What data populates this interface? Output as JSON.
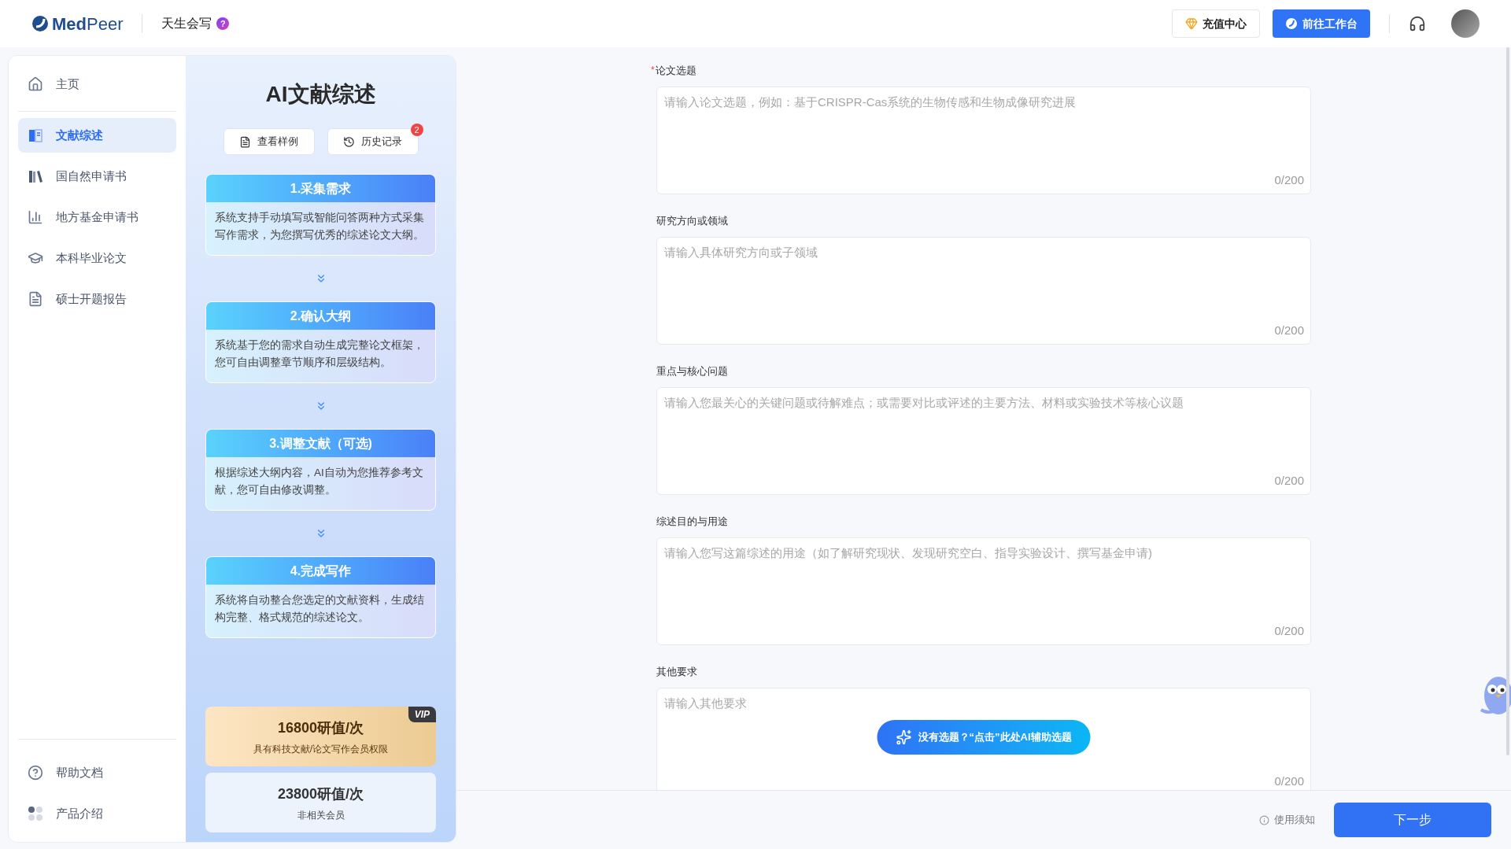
{
  "header": {
    "logo": "**Med**Peer",
    "product": "天生会写",
    "help_mark": "?",
    "buttons": [
      {
        "kind": "recharge",
        "label": "充值中心"
      },
      {
        "kind": "workbench",
        "label": "前往工作台"
      }
    ]
  },
  "sidebar": {
    "items": [
      {
        "label": "主页",
        "selected": false
      },
      {
        "label": "文献综述",
        "selected": true
      },
      {
        "label": "国自然申请书",
        "selected": false
      },
      {
        "label": "地方基金申请书",
        "selected": false
      },
      {
        "label": "本科毕业论文",
        "selected": false
      },
      {
        "label": "硕士开题报告",
        "selected": false
      }
    ],
    "bottom_items": [
      {
        "label": "帮助文档"
      },
      {
        "label": "产品介绍"
      }
    ]
  },
  "panel": {
    "title": "AI文献综述",
    "buttons": [
      {
        "kind": "sample",
        "label": "查看样例"
      },
      {
        "kind": "history",
        "label": "历史记录",
        "badge": "2"
      }
    ],
    "steps": [
      {
        "title": "1.采集需求",
        "text": "系统支持手动填写或智能问答两种方式采集写作需求，为您撰写优秀的综述论文大纲。"
      },
      {
        "title": "2.确认大纲",
        "text": "系统基于您的需求自动生成完整论文框架，您可自由调整章节顺序和层级结构。"
      },
      {
        "title": "3.调整文献（可选)",
        "text": "根据综述大纲内容，AI自动为您推荐参考文献，您可自由修改调整。"
      },
      {
        "title": "4.完成写作",
        "text": "系统将自动整合您选定的文献资料，生成结构完整、格式规范的综述论文。"
      }
    ],
    "pricing": [
      {
        "kind": "vip",
        "badge": "VIP",
        "price": "16800研值/次",
        "note": "具有科技文献/论文写作会员权限"
      },
      {
        "kind": "normal",
        "price": "23800研值/次",
        "note": "非相关会员"
      }
    ]
  },
  "form": {
    "required_mark": "*",
    "fields": [
      {
        "label": "论文选题",
        "required": true,
        "placeholder": "请输入论文选题，例如：基于CRISPR-Cas系统的生物传感和生物成像研究进展",
        "counter": "0/200"
      },
      {
        "label": "研究方向或领域",
        "required": false,
        "placeholder": "请输入具体研究方向或子领域",
        "counter": "0/200"
      },
      {
        "label": "重点与核心问题",
        "required": false,
        "placeholder": "请输入您最关心的关键问题或待解难点；或需要对比或评述的主要方法、材料或实验技术等核心议题",
        "counter": "0/200"
      },
      {
        "label": "综述目的与用途",
        "required": false,
        "placeholder": "请输入您写这篇综述的用途（如了解研究现状、发现研究空白、指导实验设计、撰写基金申请)",
        "counter": "0/200"
      },
      {
        "label": "其他要求",
        "required": false,
        "placeholder": "请输入其他要求",
        "counter": "0/200"
      }
    ],
    "ai_button": "没有选题？“点击”此处AI辅助选题"
  },
  "footer": {
    "notice": "使用须知",
    "next": "下一步"
  }
}
